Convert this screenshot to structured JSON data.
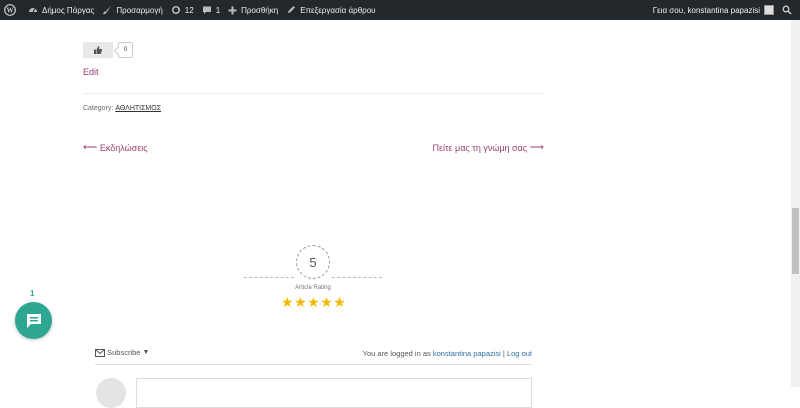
{
  "admin_bar": {
    "site_name": "Δήμος Πάργας",
    "customize": "Προσαρμογή",
    "updates_count": "12",
    "comments_count": "1",
    "new_label": "Προσθήκη",
    "edit_post": "Επεξεργασία άρθρου",
    "greeting": "Γεια σου, konstantina papazisi"
  },
  "post": {
    "like_count": "0",
    "edit_label": "Edit",
    "category_label": "Category:",
    "category_value": "ΑΘΛΗΤΙΣΜΟΣ"
  },
  "navigation": {
    "prev": "Εκδηλώσεις",
    "next": "Πείτε μας τη γνώμη σας"
  },
  "rating": {
    "value": "5",
    "label": "Article Rating",
    "stars": 5
  },
  "comments": {
    "bubble_count": "1",
    "subscribe": "Subscribe",
    "logged_in_prefix": "You are logged in as",
    "user": "konstantina papazisi",
    "separator": "|",
    "logout": "Log out"
  }
}
